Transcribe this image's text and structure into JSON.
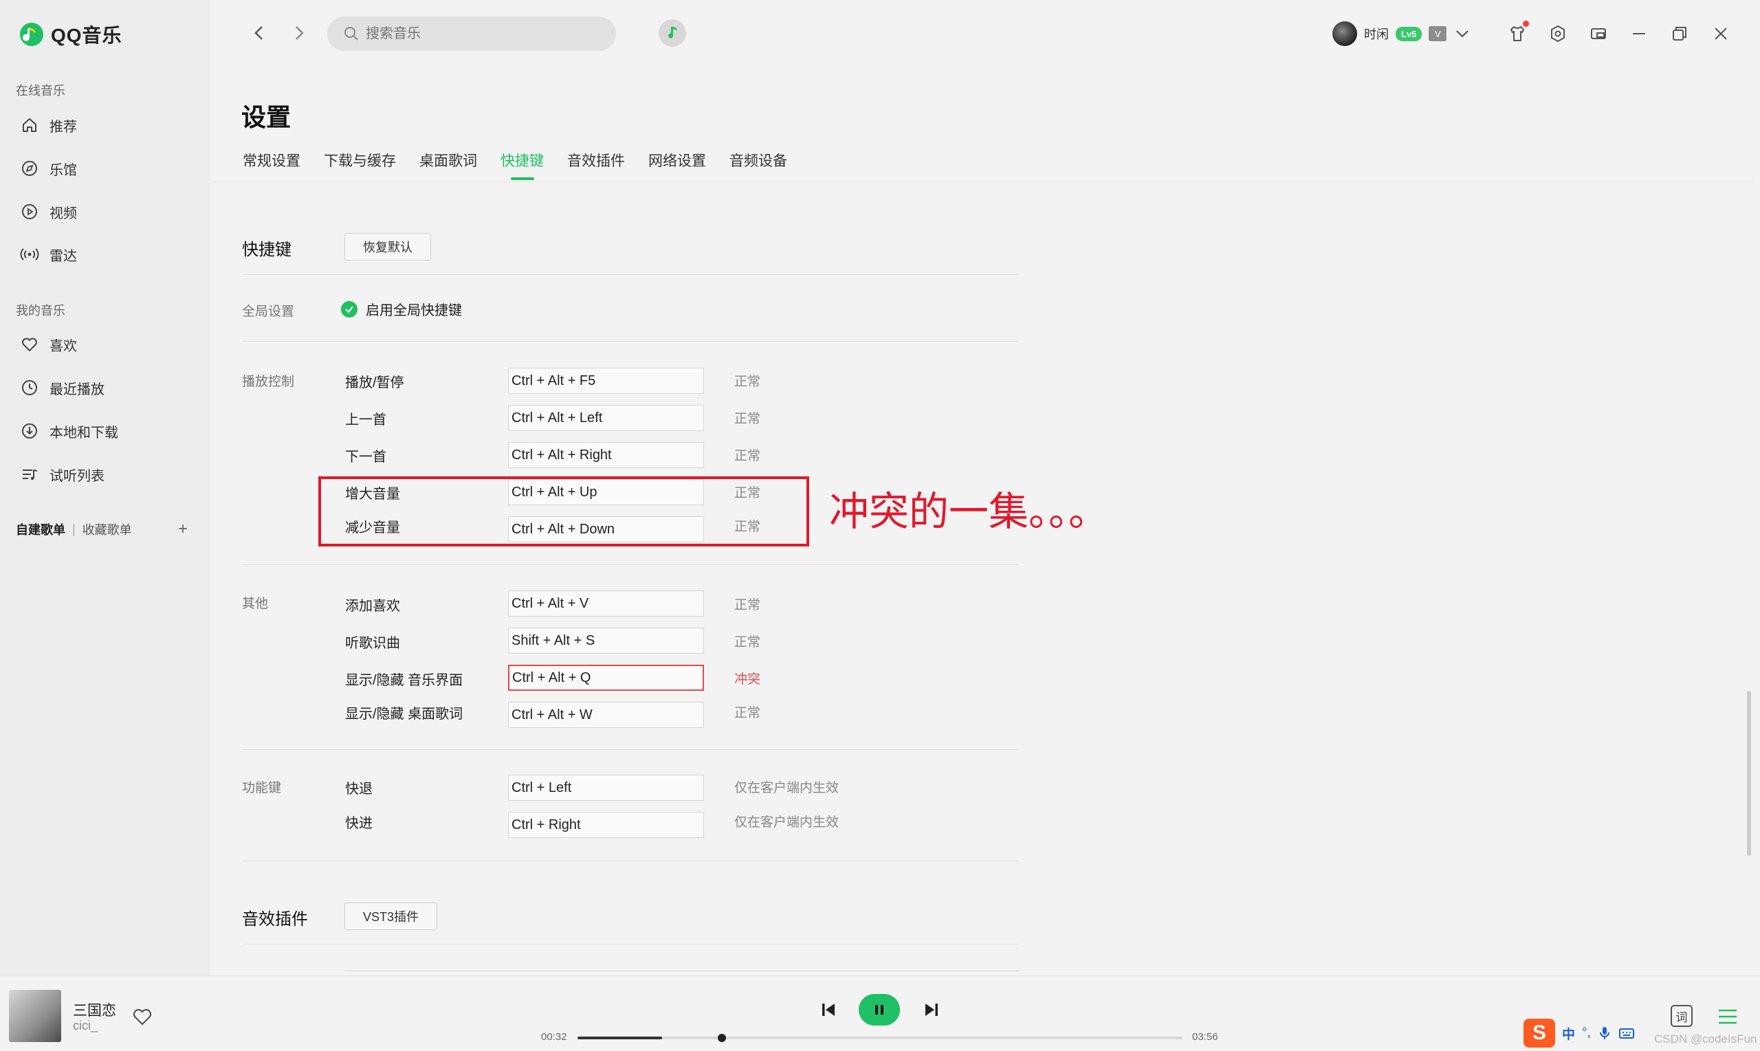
{
  "app": {
    "name": "QQ音乐"
  },
  "sidebar": {
    "online_title": "在线音乐",
    "online_items": [
      {
        "label": "推荐",
        "icon": "home-icon"
      },
      {
        "label": "乐馆",
        "icon": "compass-icon"
      },
      {
        "label": "视频",
        "icon": "video-play-icon"
      },
      {
        "label": "雷达",
        "icon": "radar-icon"
      }
    ],
    "mine_title": "我的音乐",
    "mine_items": [
      {
        "label": "喜欢",
        "icon": "heart-icon"
      },
      {
        "label": "最近播放",
        "icon": "clock-icon"
      },
      {
        "label": "本地和下载",
        "icon": "download-icon"
      },
      {
        "label": "试听列表",
        "icon": "playlist-icon"
      }
    ],
    "playlist_tabs": {
      "created": "自建歌单",
      "separator": "|",
      "collected": "收藏歌单",
      "add": "+"
    }
  },
  "topbar": {
    "search_placeholder": "搜索音乐",
    "username": "时闲",
    "level_badge": "Lv5",
    "vip_badge": "V"
  },
  "page": {
    "title": "设置",
    "tabs": [
      "常规设置",
      "下载与缓存",
      "桌面歌词",
      "快捷键",
      "音效插件",
      "网络设置",
      "音频设备"
    ],
    "active_tab": "快捷键"
  },
  "hotkeys": {
    "section_title": "快捷键",
    "restore_button": "恢复默认",
    "global_label": "全局设置",
    "global_enable": "启用全局快捷键",
    "groups": [
      {
        "label": "播放控制",
        "rows": [
          {
            "name": "播放/暂停",
            "key": "Ctrl + Alt + F5",
            "status": "正常"
          },
          {
            "name": "上一首",
            "key": "Ctrl + Alt + Left",
            "status": "正常"
          },
          {
            "name": "下一首",
            "key": "Ctrl + Alt + Right",
            "status": "正常"
          },
          {
            "name": "增大音量",
            "key": "Ctrl + Alt + Up",
            "status": "正常"
          },
          {
            "name": "减少音量",
            "key": "Ctrl + Alt + Down",
            "status": "正常"
          }
        ]
      },
      {
        "label": "其他",
        "rows": [
          {
            "name": "添加喜欢",
            "key": "Ctrl + Alt + V",
            "status": "正常"
          },
          {
            "name": "听歌识曲",
            "key": "Shift + Alt + S",
            "status": "正常"
          },
          {
            "name": "显示/隐藏 音乐界面",
            "key": "Ctrl + Alt + Q",
            "status": "冲突"
          },
          {
            "name": "显示/隐藏 桌面歌词",
            "key": "Ctrl + Alt + W",
            "status": "正常"
          }
        ]
      },
      {
        "label": "功能键",
        "rows": [
          {
            "name": "快退",
            "key": "Ctrl + Left",
            "status": "仅在客户端内生效"
          },
          {
            "name": "快进",
            "key": "Ctrl + Right",
            "status": "仅在客户端内生效"
          }
        ]
      }
    ],
    "annotation": "冲突的一集。。。"
  },
  "effects": {
    "section_title": "音效插件",
    "vst_button": "VST3插件"
  },
  "player": {
    "song": "三国恋",
    "artist": "cici_",
    "current_time": "00:32",
    "total_time": "03:56",
    "progress": 0.1356,
    "buffered": 0.14,
    "lyric_button": "词"
  },
  "ime": {
    "lang": "中",
    "punct": "°,"
  },
  "watermark": "CSDN @codeIsFun",
  "colors": {
    "accent": "#1fbf5f",
    "conflict": "#e24a4a",
    "annotation": "#e0192b"
  }
}
